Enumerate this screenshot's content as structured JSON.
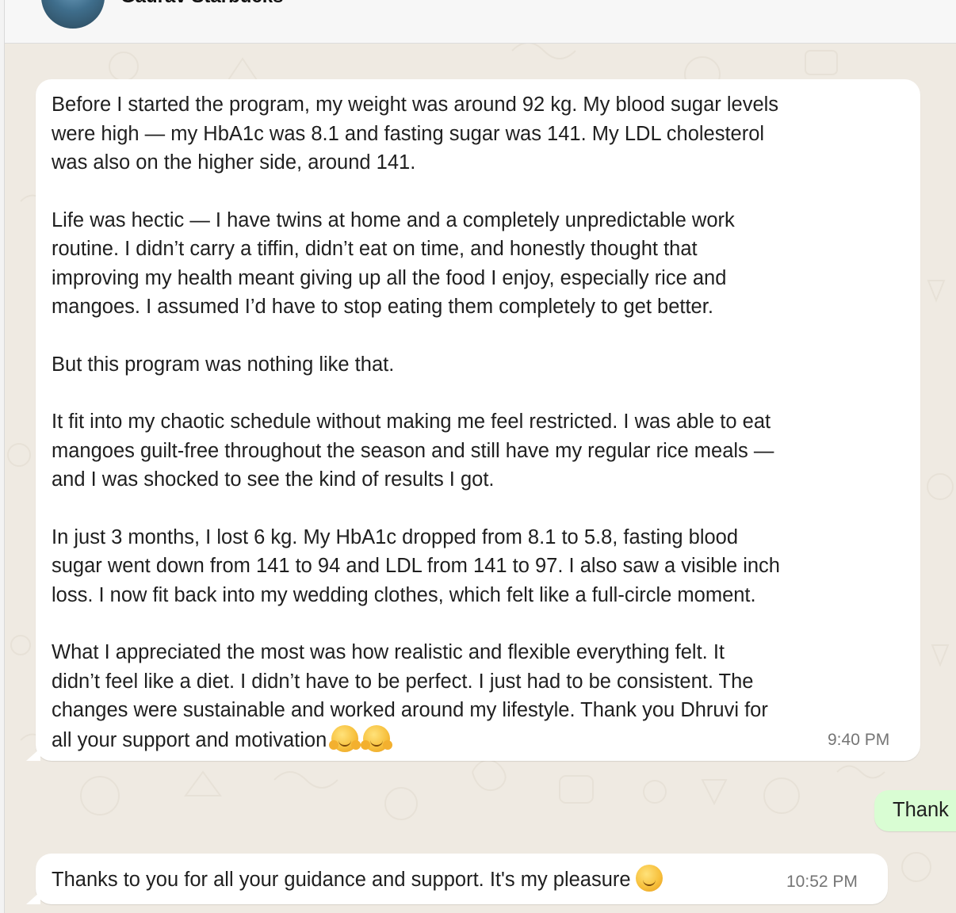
{
  "header": {
    "contact_name": "Gaurav Starbucks",
    "avatar": "contact-avatar"
  },
  "messages": [
    {
      "direction": "incoming",
      "paragraphs": [
        [
          "Before I started the program, my weight was around 92 kg. My blood sugar levels",
          "were high — my HbA1c was 8.1 and fasting sugar was 141. My LDL cholesterol",
          "was also on the higher side, around 141."
        ],
        [
          "Life was hectic — I have twins at home and a completely unpredictable work",
          "routine. I didn’t carry a tiffin, didn’t eat on time, and honestly thought that",
          "improving my health meant giving up all the food I enjoy, especially rice and",
          "mangoes. I assumed I’d have to stop eating them completely to get better."
        ],
        [
          "But this program was nothing like that."
        ],
        [
          "It fit into my chaotic schedule without making me feel restricted. I was able to eat",
          "mangoes guilt-free throughout the season and still have my regular rice meals —",
          "and I was shocked to see the kind of results I got."
        ],
        [
          "In just 3 months, I lost 6 kg. My HbA1c dropped from 8.1 to 5.8, fasting blood",
          "sugar went down from 141 to 94 and LDL from 141 to 97. I also saw a visible inch",
          "loss. I now fit back into my wedding clothes, which felt like a full-circle moment."
        ],
        [
          "What I appreciated the most was how realistic and flexible everything felt. It",
          "didn’t feel like a diet. I didn’t have to be perfect. I just had to be consistent. The",
          "changes were sustainable and worked around my lifestyle. Thank you Dhruvi for",
          "all your support and motivation"
        ]
      ],
      "emojis": [
        "hugging-face-emoji",
        "hugging-face-emoji"
      ],
      "time": "9:40 PM"
    },
    {
      "direction": "outgoing",
      "text": "Thank"
    },
    {
      "direction": "incoming",
      "text": "Thanks to you for all your guidance and support. It's my pleasure",
      "emojis": [
        "smiling-face-emoji"
      ],
      "time": "10:52 PM"
    }
  ],
  "colors": {
    "chat_background": "#efeae2",
    "incoming_bubble": "#ffffff",
    "outgoing_bubble": "#d9fdd3",
    "timestamp": "#757575"
  }
}
